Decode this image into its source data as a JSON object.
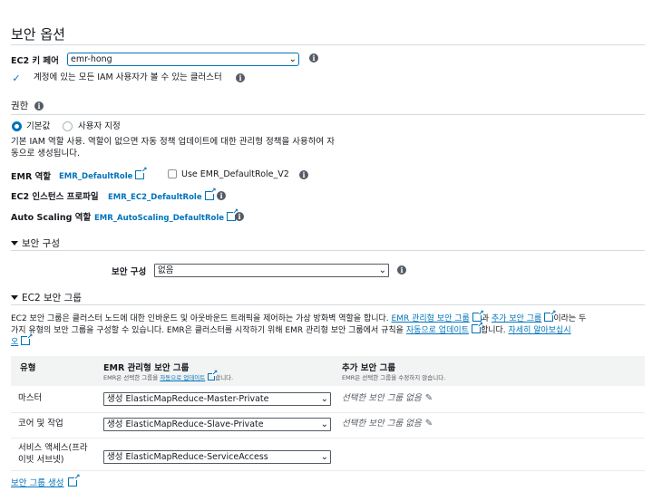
{
  "page_title": "보안 옵션",
  "ec2_key_pair": {
    "label": "EC2 키 페어",
    "value": "emr-hong"
  },
  "iam_visible": {
    "label": "계정에 있는 모든 IAM 사용자가 볼 수 있는 클러스터",
    "checked": true
  },
  "permissions": {
    "title": "권한",
    "option_default": "기본값",
    "option_custom": "사용자 지정",
    "selected": "기본값",
    "description_line1": "기본 IAM 역할 사용. 역할이 없으면 자동 정책 업데이트에 대한 관리형 정책을 사용하여 자",
    "description_line2": "동으로 생성됩니다.",
    "emr_role_label": "EMR 역할",
    "emr_role_value": "EMR_DefaultRole",
    "use_v2_label": "Use EMR_DefaultRole_V2",
    "ec2_profile_label": "EC2 인스턴스 프로파일",
    "ec2_profile_value": "EMR_EC2_DefaultRole",
    "autoscaling_label": "Auto Scaling 역할",
    "autoscaling_value": "EMR_AutoScaling_DefaultRole"
  },
  "security_config": {
    "title": "보안 구성",
    "field_label": "보안 구성",
    "value": "없음"
  },
  "ec2_sg": {
    "title": "EC2 보안 그룹",
    "desc_p1": "EC2 보안 그룹은 클러스터 노드에 대한 인바운드 및 아웃바운드 트래픽을 제어하는 가상 방화벽 역할을 합니다.",
    "link_emr_managed": "EMR 관리형 보안 그룹",
    "desc_p2": "과",
    "link_additional": "추가 보안 그룹",
    "desc_p3": "이라는 두",
    "desc_line2_p1": "가지 유형의 보안 그룹을 구성할 수 있습니다. EMR은 클러스터를 시작하기 위해 EMR 관리형 보안 그룹에서 규칙을",
    "link_auto_update": "자동으로 업데이트",
    "desc_line2_p2": "합니다.",
    "link_learn_more_1": "자세히 알아보십시",
    "link_learn_more_2": "오",
    "table": {
      "col_type": "유형",
      "col_managed": "EMR 관리형 보안 그룹",
      "col_managed_sub_p1": "EMR은 선택한 그룹을",
      "col_managed_sub_link": "자동으로 업데이트",
      "col_managed_sub_p2": "합니다.",
      "col_additional": "추가 보안 그룹",
      "col_additional_sub": "EMR은 선택한 그룹을 수정하지 않습니다.",
      "rows": [
        {
          "type": "마스터",
          "managed": "생성 ElasticMapReduce-Master-Private",
          "additional": "선택한 보안 그룹 없음"
        },
        {
          "type": "코어 및 작업",
          "managed": "생성 ElasticMapReduce-Slave-Private",
          "additional": "선택한 보안 그룹 없음"
        },
        {
          "type_line1": "서비스 액세스(프라",
          "type_line2": "이빗 서브넷)",
          "managed": "생성 ElasticMapReduce-ServiceAccess"
        }
      ]
    },
    "create_sg_link": "보안 그룹 생성"
  },
  "colors": {
    "accent": "#0073bb",
    "text": "#16191f",
    "header_bg": "#f2f3f3"
  },
  "icons": [
    "info-icon",
    "external-link-icon",
    "chevron-down-icon",
    "pencil-icon",
    "check-icon",
    "caret-down-icon"
  ]
}
